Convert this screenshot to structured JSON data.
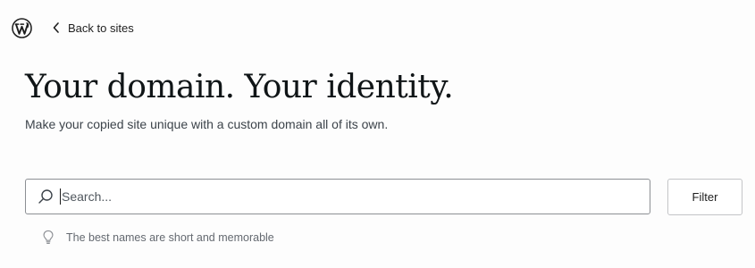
{
  "header": {
    "logo_icon": "wordpress-logo-icon",
    "back_icon": "chevron-left-icon",
    "back_label": "Back to sites"
  },
  "main": {
    "title": "Your domain. Your identity.",
    "subtitle": "Make your copied site unique with a custom domain all of its own."
  },
  "search": {
    "icon": "search-icon",
    "placeholder": "Search...",
    "value": ""
  },
  "filter": {
    "label": "Filter"
  },
  "hint": {
    "icon": "lightbulb-icon",
    "text": "The best names are short and memorable"
  },
  "colors": {
    "background": "#fdfdfd",
    "text": "#1e1e1e",
    "muted_text": "#646970",
    "border": "#8c8f94"
  }
}
